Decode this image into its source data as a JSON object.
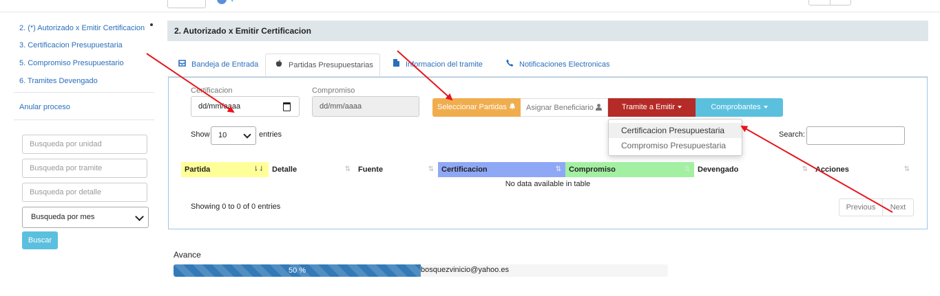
{
  "sidebar": {
    "items": [
      {
        "label": "2. (*) Autorizado x Emitir Certificacion"
      },
      {
        "label": "3. Certificacion Presupuestaria"
      },
      {
        "label": "5. Compromiso Presupuestario"
      },
      {
        "label": "6. Tramites Devengado"
      }
    ],
    "anular": "Anular proceso",
    "search": {
      "unidad_placeholder": "Busqueda por unidad",
      "tramite_placeholder": "Busqueda por tramite",
      "detalle_placeholder": "Busqueda por detalle",
      "mes_selected": "Busqueda por mes",
      "buscar_label": "Buscar"
    }
  },
  "header": {
    "title": "2. Autorizado x Emitir Certificacion"
  },
  "tabs": [
    {
      "label": "Bandeja de Entrada",
      "icon": "inbox-icon"
    },
    {
      "label": "Partidas Presupuestarias",
      "icon": "apple-icon",
      "active": true
    },
    {
      "label": "Informacion del tramite",
      "icon": "file-icon"
    },
    {
      "label": "Notificaciones Electronicas",
      "icon": "phone-icon"
    }
  ],
  "form": {
    "certificacion_label": "Certificacion",
    "certificacion_value": "dd/mm/aaaa",
    "compromiso_label": "Compromiso",
    "compromiso_value": "dd/mm/aaaa"
  },
  "toolbar": {
    "seleccionar_label": "Seleccionar Partidas",
    "asignar_label": "Asignar Beneficiario",
    "tramite_label": "Tramite a Emitir",
    "comprobantes_label": "Comprobantes"
  },
  "dropdown": {
    "items": [
      "Certificacion Presupuestaria",
      "Compromiso Presupuestaria"
    ]
  },
  "table": {
    "show_label": "Show",
    "entries_value": "10",
    "entries_label": "entries",
    "search_label": "Search:",
    "columns": [
      "Partida",
      "Detalle",
      "Fuente",
      "Certificacion",
      "Compromiso",
      "Devengado",
      "Acciones"
    ],
    "empty_message": "No data available in table",
    "info": "Showing 0 to 0 of 0 entries",
    "previous_label": "Previous",
    "next_label": "Next"
  },
  "progress": {
    "label": "Avance",
    "percent": 50,
    "text": "50 %",
    "email": "bosquezvinicio@yahoo.es"
  },
  "colors": {
    "partida_header": "#ffff99",
    "certificacion_header": "#8fa8f5",
    "compromiso_header": "#a3f0a3",
    "seleccionar_btn": "#f0ad4e",
    "tramite_btn": "#b52b27",
    "comprobantes_btn": "#5bc0de",
    "progress_bar": "#337ab7",
    "annotation_arrows": "#e8141a"
  }
}
